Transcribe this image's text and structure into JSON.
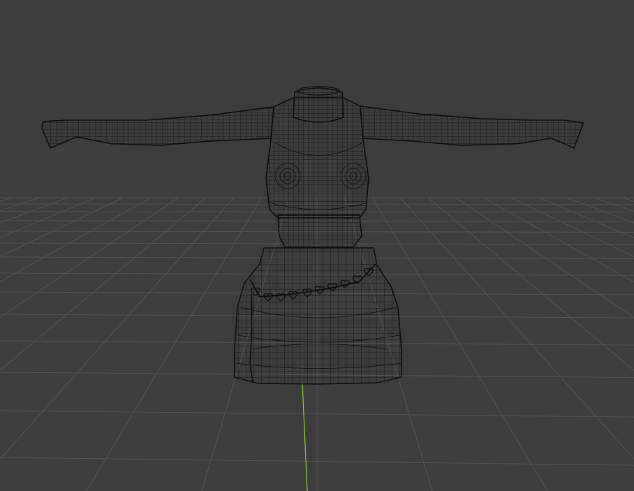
{
  "viewport": {
    "background": "#3d3d3d",
    "grid_color": "#555555",
    "y_axis_color": "#8fbf2a",
    "wire_color": "#0d0d0d",
    "shading": "wireframe",
    "object": "clothing-mesh",
    "grid_visible": true
  }
}
